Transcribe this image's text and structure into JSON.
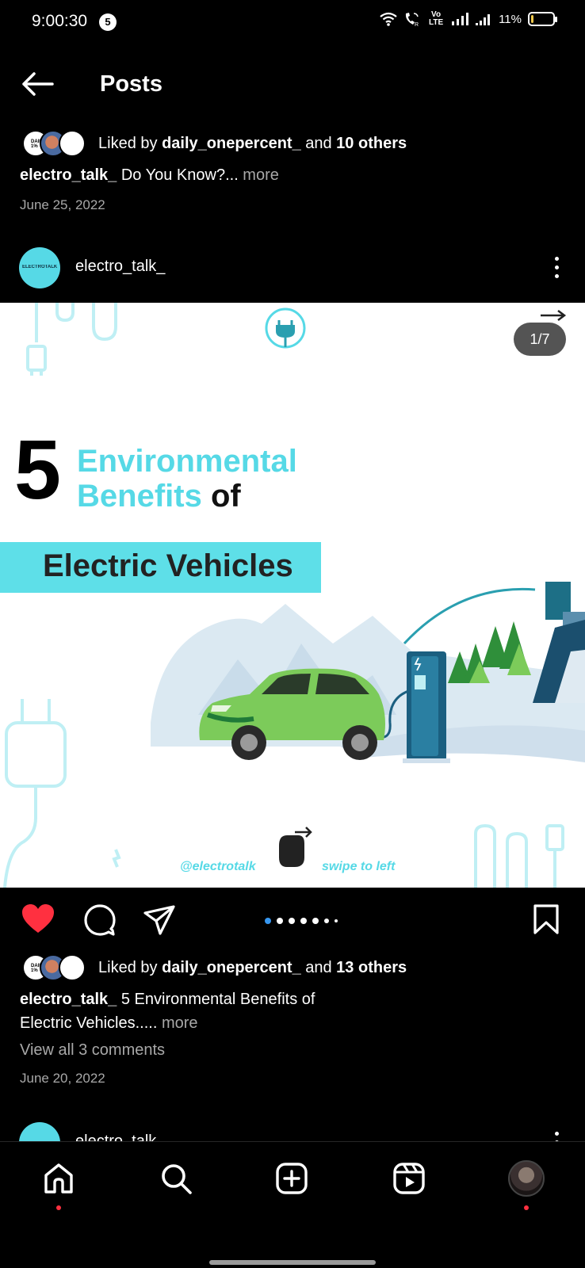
{
  "status_bar": {
    "time": "9:00:30",
    "notification_count": "5",
    "network_label": "Vo LTE",
    "battery_percent": "11%",
    "battery_level": 0.11
  },
  "header": {
    "title": "Posts"
  },
  "previous_post": {
    "liked_by_prefix": "Liked by ",
    "liked_by_user": "daily_onepercent_",
    "liked_by_and": " and ",
    "liked_by_others": "10 others",
    "caption_user": "electro_talk_",
    "caption_text": " Do You Know?...",
    "more_label": " more",
    "date": "June 25, 2022"
  },
  "post": {
    "username": "electro_talk_",
    "avatar_text": "ELECTROTALK",
    "image": {
      "counter": "1/7",
      "big_number": "5",
      "title_line1": "Environmental",
      "title_line2": "Benefits",
      "title_of": "of",
      "banner_text": "Electric Vehicles",
      "handle": "@electrotalk",
      "swipe_text": "swipe to left"
    },
    "liked_by_prefix": "Liked by ",
    "liked_by_user": "daily_onepercent_",
    "liked_by_and": " and ",
    "liked_by_others": "13 others",
    "caption_user": "electro_talk_",
    "caption_text": " 5 Environmental Benefits of Electric Vehicles.....",
    "more_label": " more",
    "comments_link": "View all 3 comments",
    "date": "June 20, 2022",
    "carousel_total": 7,
    "carousel_active": 1,
    "liked": true
  },
  "next_post": {
    "username": "electro_talk_"
  },
  "colors": {
    "accent_blue": "#3797f0",
    "like_red": "#ff3040",
    "brand_cyan": "#56d9e6"
  },
  "bottom_nav": [
    "home-icon",
    "search-icon",
    "create-icon",
    "reels-icon",
    "profile-avatar"
  ]
}
